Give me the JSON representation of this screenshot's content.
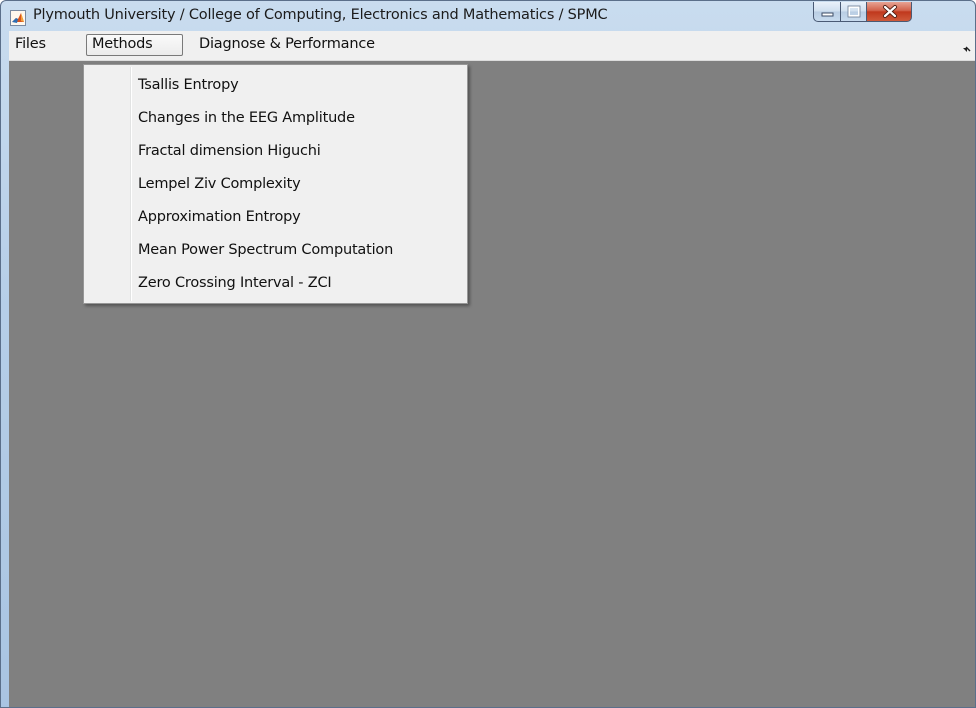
{
  "window": {
    "title": "Plymouth University / College of Computing, Electronics and Mathematics / SPMC",
    "app_icon": "matlab-icon",
    "controls": [
      "minimize-icon",
      "maximize-icon",
      "close-icon"
    ]
  },
  "menubar": {
    "items": [
      {
        "label": "Files"
      },
      {
        "label": "Methods",
        "active": true
      },
      {
        "label": "Diagnose & Performance"
      }
    ],
    "overflow_icon": "toolbar-arrow-icon"
  },
  "methods_menu": {
    "items": [
      {
        "label": "Tsallis Entropy"
      },
      {
        "label": "Changes in the EEG Amplitude"
      },
      {
        "label": "Fractal dimension Higuchi"
      },
      {
        "label": "Lempel Ziv Complexity"
      },
      {
        "label": "Approximation Entropy"
      },
      {
        "label": "Mean Power Spectrum Computation"
      },
      {
        "label": "Zero Crossing Interval - ZCI"
      }
    ]
  },
  "colors": {
    "figure_background": "#808080",
    "menu_background": "#f0f0f0",
    "close_button": "#c0381d"
  }
}
